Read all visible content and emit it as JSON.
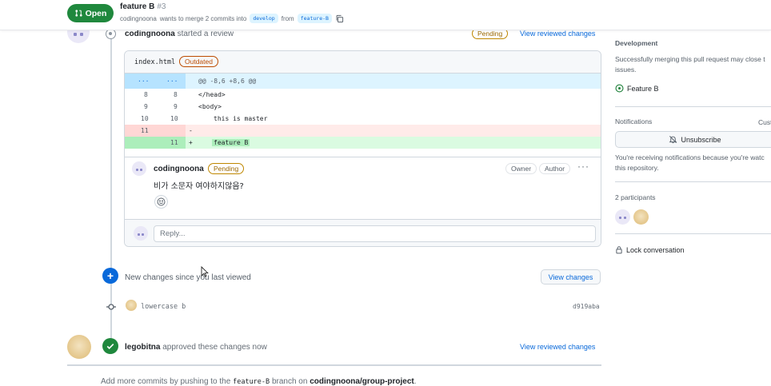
{
  "header": {
    "state_label": "Open",
    "title": "feature B",
    "number": "#3",
    "author": "codingnoona",
    "merge_text": "wants to merge 2 commits into",
    "base_branch": "develop",
    "from_text": "from",
    "head_branch": "feature-B"
  },
  "review": {
    "user": "codingnoona",
    "action": "started a review",
    "status": "Pending",
    "view_reviewed": "View reviewed changes"
  },
  "diff": {
    "file_name": "index.html",
    "file_status": "Outdated",
    "hunk_left": "...",
    "hunk_right": "...",
    "hunk_header": "@@ -8,6 +8,6 @@",
    "rows": [
      {
        "old": "8",
        "new": "8",
        "sign": "",
        "code": "</head>"
      },
      {
        "old": "9",
        "new": "9",
        "sign": "",
        "code": "<body>"
      },
      {
        "old": "10",
        "new": "10",
        "sign": "",
        "code": "this is master"
      },
      {
        "old": "11",
        "new": "",
        "sign": "-",
        "code": ""
      },
      {
        "old": "",
        "new": "11",
        "sign": "+",
        "code": "feature B"
      }
    ]
  },
  "comment": {
    "user": "codingnoona",
    "status": "Pending",
    "owner_label": "Owner",
    "author_label": "Author",
    "menu": "···",
    "body": "비가 소문자 여야하지않음?",
    "reply_placeholder": "Reply..."
  },
  "new_changes": {
    "text": "New changes since you last viewed",
    "button": "View changes"
  },
  "commit": {
    "message": "lowercase b",
    "sha": "d919aba"
  },
  "approval": {
    "user": "legobitna",
    "action": "approved these changes now",
    "view_reviewed": "View reviewed changes"
  },
  "footer": {
    "prefix": "Add more commits by pushing to the",
    "branch": "feature-B",
    "middle": "branch on",
    "repo": "codingnoona/group-project",
    "suffix": "."
  },
  "sidebar": {
    "development_label": "Development",
    "development_text_1": "Successfully merging this pull request may close t",
    "development_text_2": "issues.",
    "linked_issue": "Feature B",
    "notifications_label": "Notifications",
    "customize": "Cust",
    "unsubscribe": "Unsubscribe",
    "notif_text_1": "You're receiving notifications because you're watc",
    "notif_text_2": "this repository.",
    "participants_label": "2 participants",
    "lock": "Lock conversation"
  }
}
